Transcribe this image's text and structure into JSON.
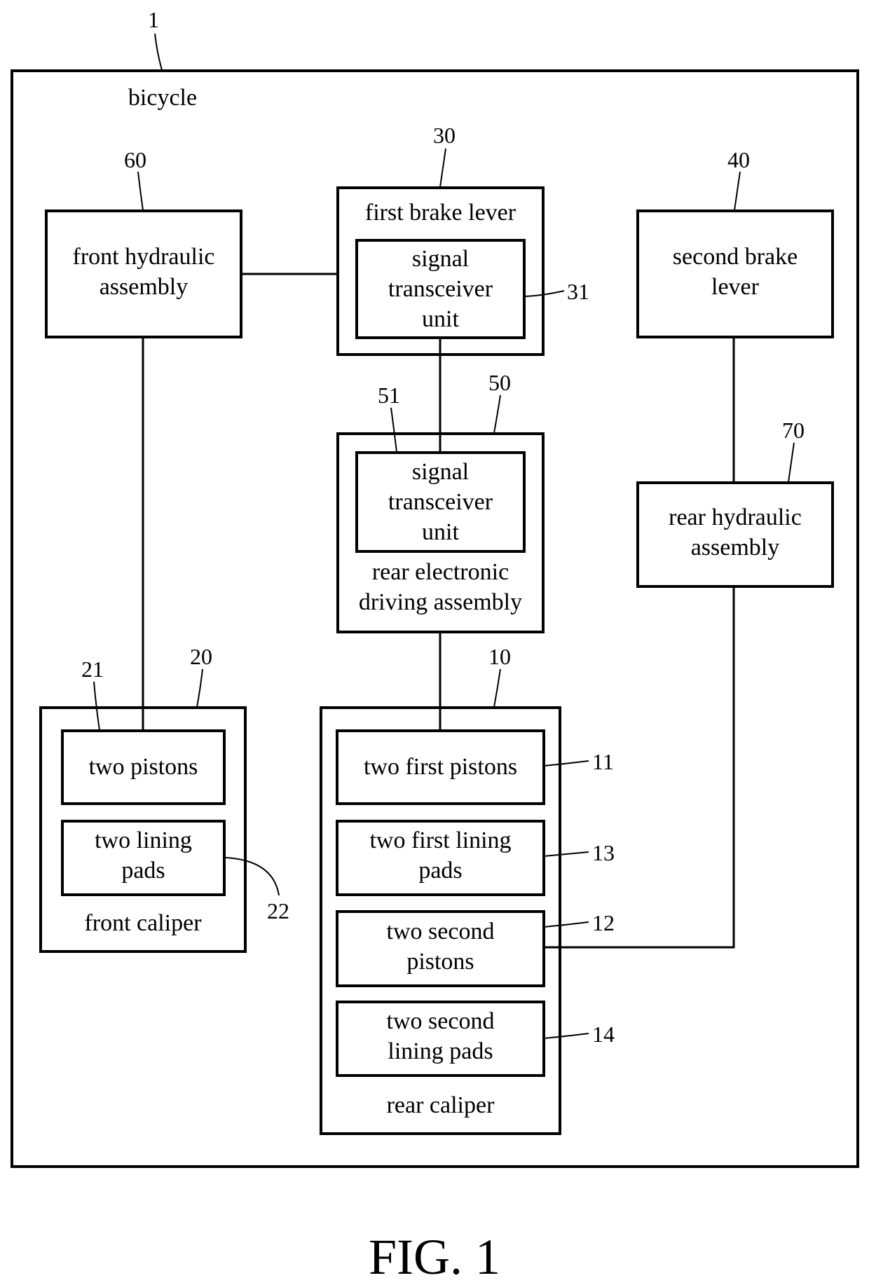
{
  "figure": {
    "caption": "FIG. 1",
    "system": {
      "ref": "1",
      "label": "bicycle"
    }
  },
  "components": {
    "front_hydraulic": {
      "ref": "60",
      "label": "front hydraulic\nassembly"
    },
    "first_brake_lever": {
      "ref": "30",
      "label": "first brake lever"
    },
    "first_signal_unit": {
      "ref": "31",
      "label": "signal\ntransceiver\nunit"
    },
    "second_brake_lever": {
      "ref": "40",
      "label": "second brake\nlever"
    },
    "rear_electronic": {
      "ref": "50",
      "label": "rear electronic\ndriving assembly"
    },
    "rear_signal_unit": {
      "ref": "51",
      "label": "signal\ntransceiver\nunit"
    },
    "rear_hydraulic": {
      "ref": "70",
      "label": "rear hydraulic\nassembly"
    },
    "front_caliper": {
      "ref": "20",
      "label": "front caliper"
    },
    "front_pistons": {
      "ref": "21",
      "label": "two pistons"
    },
    "front_pads": {
      "ref": "22",
      "label": "two lining\npads"
    },
    "rear_caliper": {
      "ref": "10",
      "label": "rear caliper"
    },
    "rear_first_pistons": {
      "ref": "11",
      "label": "two first pistons"
    },
    "rear_first_pads": {
      "ref": "13",
      "label": "two first lining\npads"
    },
    "rear_second_pistons": {
      "ref": "12",
      "label": "two second\npistons"
    },
    "rear_second_pads": {
      "ref": "14",
      "label": "two second\nlining pads"
    }
  },
  "connections": [
    {
      "from": "front_hydraulic",
      "to": "first_brake_lever"
    },
    {
      "from": "front_hydraulic",
      "to": "front_pistons"
    },
    {
      "from": "first_signal_unit",
      "to": "rear_signal_unit"
    },
    {
      "from": "rear_electronic",
      "to": "rear_first_pistons"
    },
    {
      "from": "second_brake_lever",
      "to": "rear_hydraulic"
    },
    {
      "from": "rear_hydraulic",
      "to": "rear_second_pistons"
    }
  ]
}
